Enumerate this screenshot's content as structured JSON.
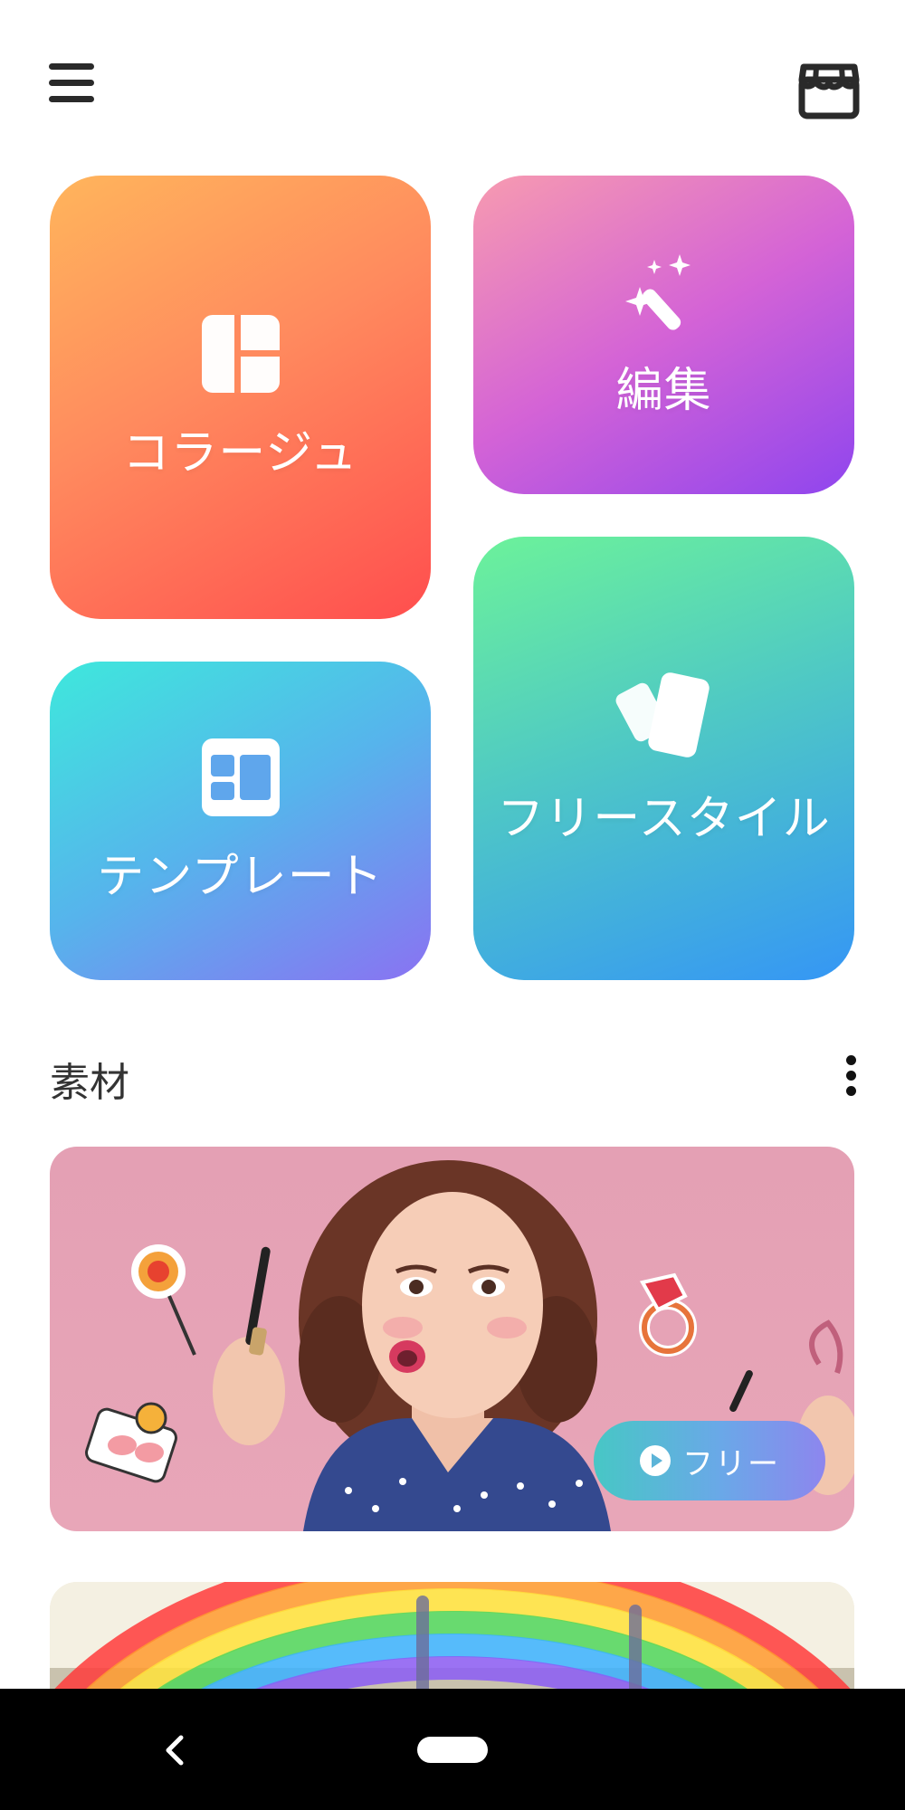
{
  "header": {
    "menu_icon": "hamburger-menu-icon",
    "store_icon": "store-icon"
  },
  "tiles": {
    "collage": {
      "label": "コラージュ",
      "icon": "collage-layout-icon",
      "colors": [
        "#ffb55c",
        "#ff4e4e"
      ]
    },
    "edit": {
      "label": "編集",
      "icon": "magic-wand-icon",
      "colors": [
        "#f79bb0",
        "#8f45ee"
      ]
    },
    "template": {
      "label": "テンプレート",
      "icon": "template-grid-icon",
      "colors": [
        "#3ee8dc",
        "#8a72f2"
      ]
    },
    "freestyle": {
      "label": "フリースタイル",
      "icon": "cards-icon",
      "colors": [
        "#6cf29a",
        "#3596f5"
      ]
    }
  },
  "materials": {
    "title": "素材",
    "more_icon": "more-vertical-icon",
    "banners": [
      {
        "name": "makeup-sticker-banner",
        "badge_label": "フリー",
        "badge_icon": "play-circle-icon"
      },
      {
        "name": "rainbow-banner"
      }
    ]
  },
  "navbar": {
    "back_icon": "back-chevron-icon",
    "home_icon": "home-pill-icon"
  }
}
